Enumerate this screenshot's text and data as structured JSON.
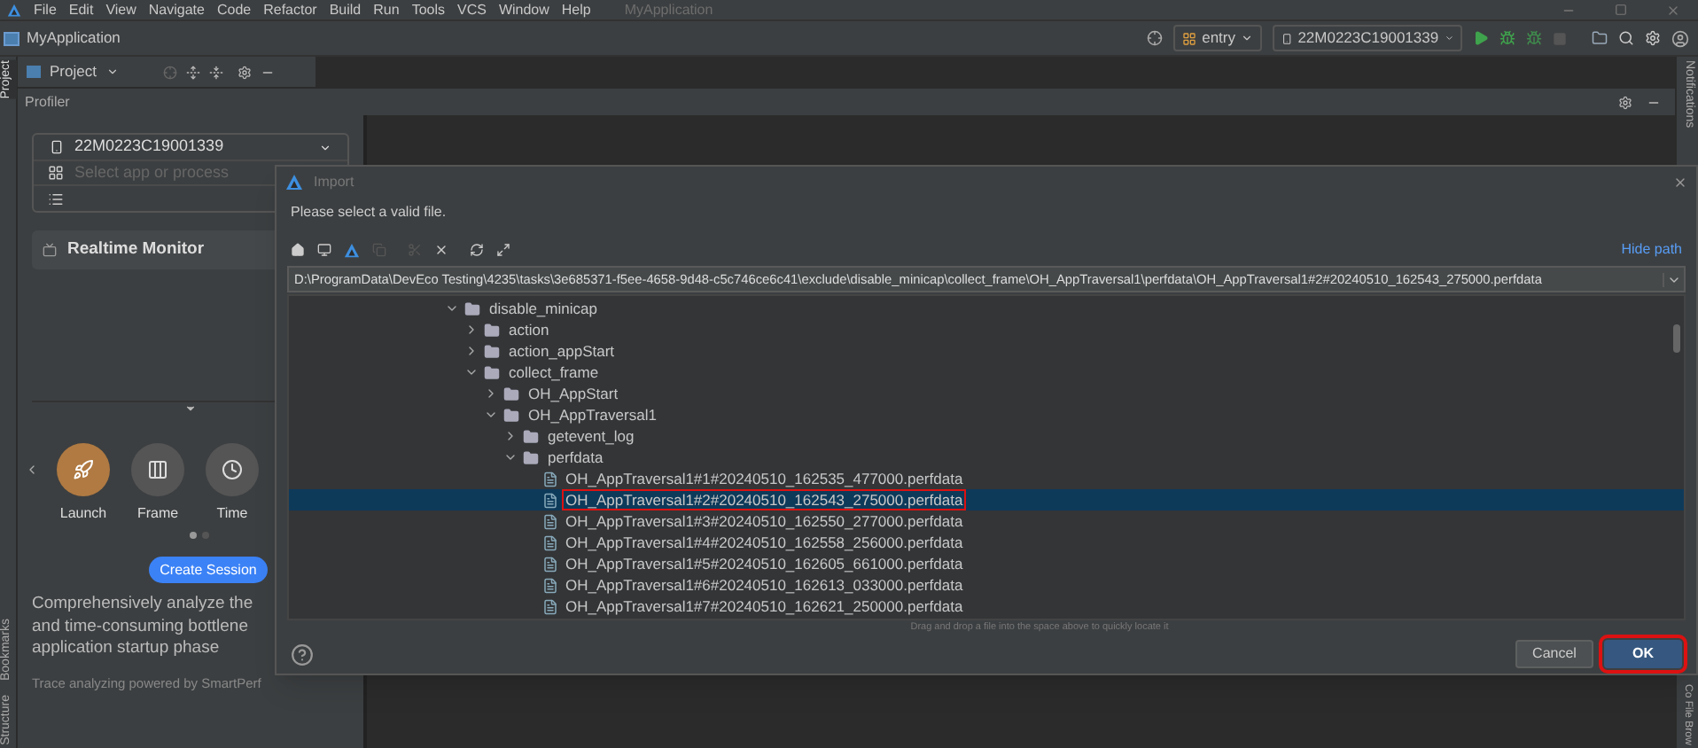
{
  "menu_bar": {
    "items": [
      "File",
      "Edit",
      "View",
      "Navigate",
      "Code",
      "Refactor",
      "Build",
      "Run",
      "Tools",
      "VCS",
      "Window",
      "Help"
    ],
    "project_title": "MyApplication"
  },
  "navigation": {
    "breadcrumb": "MyApplication",
    "run_config": "entry",
    "device": "22M0223C19001339"
  },
  "left_strip": {
    "top": [
      {
        "label": "Project",
        "selected": true
      }
    ],
    "bottom": [
      {
        "label": "Bookmarks",
        "selected": false
      },
      {
        "label": "Structure",
        "selected": false
      }
    ]
  },
  "right_strip": {
    "top": "Notifications",
    "bottom": "Co File Brow"
  },
  "project_toolbar": {
    "label": "Project"
  },
  "profiler": {
    "title": "Profiler",
    "device": "22M0223C19001339",
    "process_placeholder": "Select app or process",
    "realtime_monitor": "Realtime Monitor",
    "session_types": [
      {
        "label": "Launch",
        "kind": "launch",
        "selected": true
      },
      {
        "label": "Frame",
        "kind": "frame",
        "selected": false
      },
      {
        "label": "Time",
        "kind": "time",
        "selected": false
      }
    ],
    "pages": [
      {
        "selected": true
      },
      {
        "selected": false
      }
    ],
    "create_button": "Create Session",
    "description_lines": [
      "Comprehensively analyze the",
      "and time-consuming bottlene",
      "application startup phase"
    ],
    "footer": "Trace analyzing powered by SmartPerf"
  },
  "dialog": {
    "title": "Import",
    "message": "Please select a valid file.",
    "hide_path": "Hide path",
    "path": "D:\\ProgramData\\DevEco Testing\\4235\\tasks\\3e685371-f5ee-4658-9d48-c5c746ce6c41\\exclude\\disable_minicap\\collect_frame\\OH_AppTraversal1\\perfdata\\OH_AppTraversal1#2#20240510_162543_275000.perfdata",
    "tree": [
      {
        "label": "disable_minicap",
        "kind": "folder",
        "expanded": true,
        "selected": false,
        "children": [
          {
            "label": "action",
            "kind": "folder",
            "expanded": false,
            "selected": false
          },
          {
            "label": "action_appStart",
            "kind": "folder",
            "expanded": false,
            "selected": false
          },
          {
            "label": "collect_frame",
            "kind": "folder",
            "expanded": true,
            "selected": false,
            "children": [
              {
                "label": "OH_AppStart",
                "kind": "folder",
                "expanded": false,
                "selected": false
              },
              {
                "label": "OH_AppTraversal1",
                "kind": "folder",
                "expanded": true,
                "selected": false,
                "children": [
                  {
                    "label": "getevent_log",
                    "kind": "folder",
                    "expanded": false,
                    "selected": false
                  },
                  {
                    "label": "perfdata",
                    "kind": "folder",
                    "expanded": true,
                    "selected": false,
                    "children": [
                      {
                        "label": "OH_AppTraversal1#1#20240510_162535_477000.perfdata",
                        "kind": "file",
                        "selected": false,
                        "highlighted": false
                      },
                      {
                        "label": "OH_AppTraversal1#2#20240510_162543_275000.perfdata",
                        "kind": "file",
                        "selected": true,
                        "highlighted": true
                      },
                      {
                        "label": "OH_AppTraversal1#3#20240510_162550_277000.perfdata",
                        "kind": "file",
                        "selected": false,
                        "highlighted": false
                      },
                      {
                        "label": "OH_AppTraversal1#4#20240510_162558_256000.perfdata",
                        "kind": "file",
                        "selected": false,
                        "highlighted": false
                      },
                      {
                        "label": "OH_AppTraversal1#5#20240510_162605_661000.perfdata",
                        "kind": "file",
                        "selected": false,
                        "highlighted": false
                      },
                      {
                        "label": "OH_AppTraversal1#6#20240510_162613_033000.perfdata",
                        "kind": "file",
                        "selected": false,
                        "highlighted": false
                      },
                      {
                        "label": "OH_AppTraversal1#7#20240510_162621_250000.perfdata",
                        "kind": "file",
                        "selected": false,
                        "highlighted": false
                      }
                    ]
                  }
                ]
              }
            ]
          }
        ]
      }
    ],
    "hint": "Drag and drop a file into the space above to quickly locate it",
    "buttons": [
      {
        "label": "Cancel",
        "kind": "cancel",
        "highlighted": false
      },
      {
        "label": "OK",
        "kind": "ok",
        "highlighted": true
      }
    ]
  }
}
